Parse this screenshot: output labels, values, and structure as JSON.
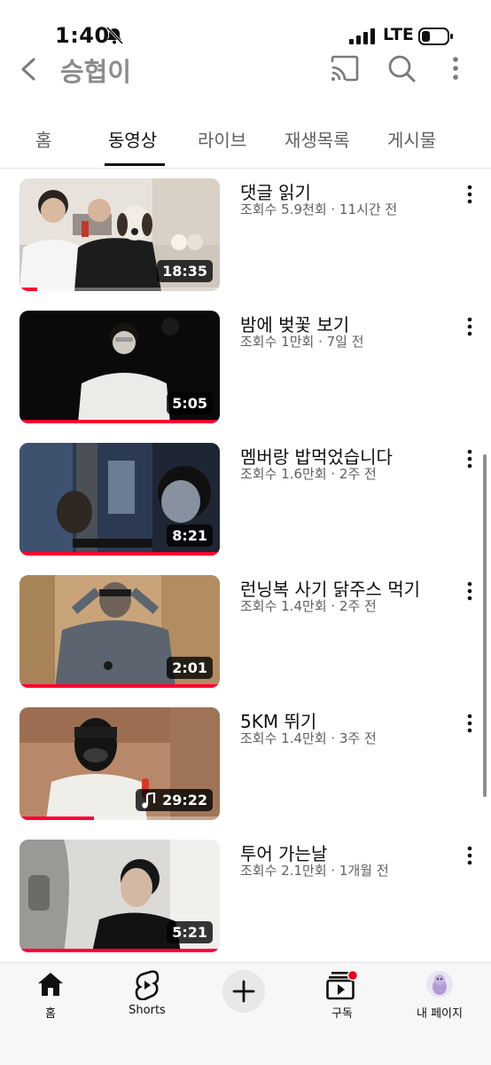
{
  "status_bar": {
    "time": "1:40",
    "network": "LTE"
  },
  "header": {
    "title": "승협이"
  },
  "tabs": [
    {
      "label": "홈"
    },
    {
      "label": "동영상"
    },
    {
      "label": "라이브"
    },
    {
      "label": "재생목록"
    },
    {
      "label": "게시물"
    }
  ],
  "active_tab": "동영상",
  "videos": [
    {
      "title": "댓글 읽기",
      "meta": "조회수 5.9천회 · 11시간 전",
      "duration": "18:35",
      "watched_fraction": 0.09
    },
    {
      "title": "밤에 벚꽃 보기",
      "meta": "조회수 1만회 · 7일 전",
      "duration": "5:05",
      "watched_fraction": 1.0
    },
    {
      "title": "멤버랑 밥먹었습니다",
      "meta": "조회수 1.6만회 · 2주 전",
      "duration": "8:21",
      "watched_fraction": 1.0
    },
    {
      "title": "런닝복 사기 닭주스 먹기",
      "meta": "조회수 1.4만회 · 2주 전",
      "duration": "2:01",
      "watched_fraction": 1.0
    },
    {
      "title": "5KM 뛰기",
      "meta": "조회수 1.4만회 · 3주 전",
      "duration": "29:22",
      "watched_fraction": 0.37,
      "audio_icon": "music-note-icon"
    },
    {
      "title": "투어 가는날",
      "meta": "조회수 2.1만회 · 1개월 전",
      "duration": "5:21",
      "watched_fraction": 1.0
    }
  ],
  "bottom_nav": {
    "home": "홈",
    "shorts": "Shorts",
    "subscriptions": "구독",
    "my_page": "내 페이지"
  },
  "colors": {
    "accent": "#ff0033",
    "title_gray": "#8c8c8c",
    "meta_gray": "#606060"
  }
}
